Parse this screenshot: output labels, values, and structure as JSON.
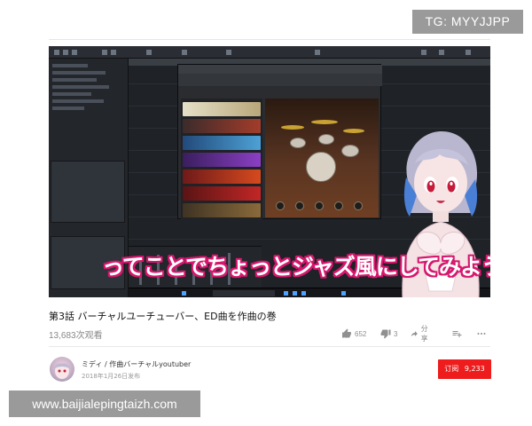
{
  "overlay": {
    "tg_badge": "TG: MYYJJPP",
    "website_watermark": "www.baijialepingtaizh.com"
  },
  "video": {
    "caption": "ってことでちょっとジャズ風にしてみよう！",
    "caption_stroke_color": "#d6186f"
  },
  "info": {
    "title": "第3話 バーチャルユーチューバー、ED曲を作曲の巻",
    "views": "13,683次观看",
    "likes": "652",
    "dislikes": "3",
    "share_label": "分享",
    "icons": [
      "thumbs-up-icon",
      "thumbs-down-icon",
      "share-icon",
      "add-to-playlist-icon",
      "more-icon"
    ]
  },
  "channel": {
    "name": "ミディ / 作曲バーチャルyoutuber",
    "published": "2018年1月26日发布",
    "subscribe_label": "订阅",
    "subscriber_count": "9,233",
    "subscribe_color": "#ee1c1c"
  }
}
